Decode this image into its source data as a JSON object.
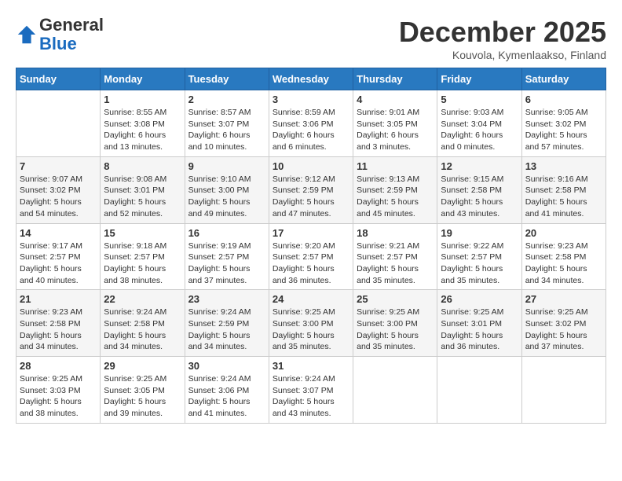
{
  "header": {
    "logo_general": "General",
    "logo_blue": "Blue",
    "month": "December 2025",
    "location": "Kouvola, Kymenlaakso, Finland"
  },
  "weekdays": [
    "Sunday",
    "Monday",
    "Tuesday",
    "Wednesday",
    "Thursday",
    "Friday",
    "Saturday"
  ],
  "weeks": [
    [
      {
        "day": "",
        "info": ""
      },
      {
        "day": "1",
        "info": "Sunrise: 8:55 AM\nSunset: 3:08 PM\nDaylight: 6 hours\nand 13 minutes."
      },
      {
        "day": "2",
        "info": "Sunrise: 8:57 AM\nSunset: 3:07 PM\nDaylight: 6 hours\nand 10 minutes."
      },
      {
        "day": "3",
        "info": "Sunrise: 8:59 AM\nSunset: 3:06 PM\nDaylight: 6 hours\nand 6 minutes."
      },
      {
        "day": "4",
        "info": "Sunrise: 9:01 AM\nSunset: 3:05 PM\nDaylight: 6 hours\nand 3 minutes."
      },
      {
        "day": "5",
        "info": "Sunrise: 9:03 AM\nSunset: 3:04 PM\nDaylight: 6 hours\nand 0 minutes."
      },
      {
        "day": "6",
        "info": "Sunrise: 9:05 AM\nSunset: 3:02 PM\nDaylight: 5 hours\nand 57 minutes."
      }
    ],
    [
      {
        "day": "7",
        "info": "Sunrise: 9:07 AM\nSunset: 3:02 PM\nDaylight: 5 hours\nand 54 minutes."
      },
      {
        "day": "8",
        "info": "Sunrise: 9:08 AM\nSunset: 3:01 PM\nDaylight: 5 hours\nand 52 minutes."
      },
      {
        "day": "9",
        "info": "Sunrise: 9:10 AM\nSunset: 3:00 PM\nDaylight: 5 hours\nand 49 minutes."
      },
      {
        "day": "10",
        "info": "Sunrise: 9:12 AM\nSunset: 2:59 PM\nDaylight: 5 hours\nand 47 minutes."
      },
      {
        "day": "11",
        "info": "Sunrise: 9:13 AM\nSunset: 2:59 PM\nDaylight: 5 hours\nand 45 minutes."
      },
      {
        "day": "12",
        "info": "Sunrise: 9:15 AM\nSunset: 2:58 PM\nDaylight: 5 hours\nand 43 minutes."
      },
      {
        "day": "13",
        "info": "Sunrise: 9:16 AM\nSunset: 2:58 PM\nDaylight: 5 hours\nand 41 minutes."
      }
    ],
    [
      {
        "day": "14",
        "info": "Sunrise: 9:17 AM\nSunset: 2:57 PM\nDaylight: 5 hours\nand 40 minutes."
      },
      {
        "day": "15",
        "info": "Sunrise: 9:18 AM\nSunset: 2:57 PM\nDaylight: 5 hours\nand 38 minutes."
      },
      {
        "day": "16",
        "info": "Sunrise: 9:19 AM\nSunset: 2:57 PM\nDaylight: 5 hours\nand 37 minutes."
      },
      {
        "day": "17",
        "info": "Sunrise: 9:20 AM\nSunset: 2:57 PM\nDaylight: 5 hours\nand 36 minutes."
      },
      {
        "day": "18",
        "info": "Sunrise: 9:21 AM\nSunset: 2:57 PM\nDaylight: 5 hours\nand 35 minutes."
      },
      {
        "day": "19",
        "info": "Sunrise: 9:22 AM\nSunset: 2:57 PM\nDaylight: 5 hours\nand 35 minutes."
      },
      {
        "day": "20",
        "info": "Sunrise: 9:23 AM\nSunset: 2:58 PM\nDaylight: 5 hours\nand 34 minutes."
      }
    ],
    [
      {
        "day": "21",
        "info": "Sunrise: 9:23 AM\nSunset: 2:58 PM\nDaylight: 5 hours\nand 34 minutes."
      },
      {
        "day": "22",
        "info": "Sunrise: 9:24 AM\nSunset: 2:58 PM\nDaylight: 5 hours\nand 34 minutes."
      },
      {
        "day": "23",
        "info": "Sunrise: 9:24 AM\nSunset: 2:59 PM\nDaylight: 5 hours\nand 34 minutes."
      },
      {
        "day": "24",
        "info": "Sunrise: 9:25 AM\nSunset: 3:00 PM\nDaylight: 5 hours\nand 35 minutes."
      },
      {
        "day": "25",
        "info": "Sunrise: 9:25 AM\nSunset: 3:00 PM\nDaylight: 5 hours\nand 35 minutes."
      },
      {
        "day": "26",
        "info": "Sunrise: 9:25 AM\nSunset: 3:01 PM\nDaylight: 5 hours\nand 36 minutes."
      },
      {
        "day": "27",
        "info": "Sunrise: 9:25 AM\nSunset: 3:02 PM\nDaylight: 5 hours\nand 37 minutes."
      }
    ],
    [
      {
        "day": "28",
        "info": "Sunrise: 9:25 AM\nSunset: 3:03 PM\nDaylight: 5 hours\nand 38 minutes."
      },
      {
        "day": "29",
        "info": "Sunrise: 9:25 AM\nSunset: 3:05 PM\nDaylight: 5 hours\nand 39 minutes."
      },
      {
        "day": "30",
        "info": "Sunrise: 9:24 AM\nSunset: 3:06 PM\nDaylight: 5 hours\nand 41 minutes."
      },
      {
        "day": "31",
        "info": "Sunrise: 9:24 AM\nSunset: 3:07 PM\nDaylight: 5 hours\nand 43 minutes."
      },
      {
        "day": "",
        "info": ""
      },
      {
        "day": "",
        "info": ""
      },
      {
        "day": "",
        "info": ""
      }
    ]
  ]
}
